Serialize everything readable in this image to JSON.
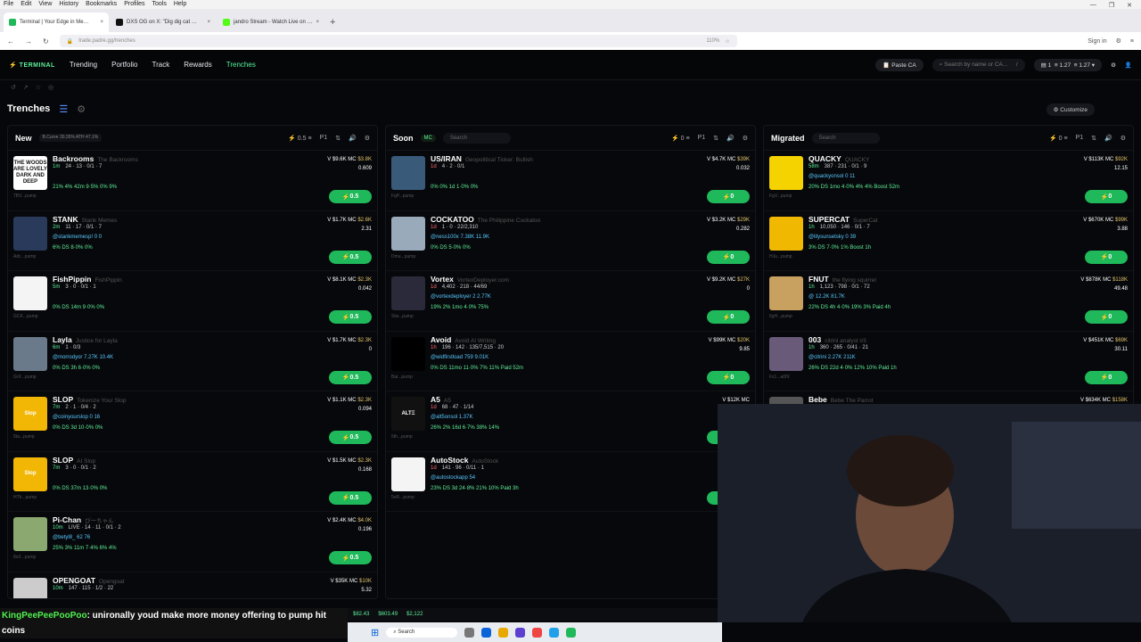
{
  "browser": {
    "menus": [
      "File",
      "Edit",
      "View",
      "History",
      "Bookmarks",
      "Profiles",
      "Tools",
      "Help"
    ],
    "tabs": [
      {
        "label": "Terminal | Your Edge in Me…",
        "color": "#1fb85a"
      },
      {
        "label": "DXS OG on X: \"Dig dig cat …",
        "color": "#111"
      },
      {
        "label": "jandro Stream - Watch Live on …",
        "color": "#53fc18"
      }
    ],
    "url": "trade.padre.gg/trenches",
    "zoom": "110%",
    "signin": "Sign in"
  },
  "header": {
    "logo": "TERMINAL",
    "nav": [
      "Trending",
      "Portfolio",
      "Track",
      "Rewards",
      "Trenches"
    ],
    "active": "Trenches",
    "paste": "Paste CA",
    "search_placeholder": "Search by name or CA...",
    "search_key": "/",
    "wallet": "1",
    "bal1": "1.27",
    "bal2": "1.27"
  },
  "page": {
    "title": "Trenches",
    "customize": "Customize"
  },
  "colors": {
    "accent": "#53f29a",
    "buy": "#1fb85a",
    "handle": "#57c8ff",
    "mc": "#e3c46b"
  },
  "columns": [
    {
      "name": "New",
      "curve": "B.Curve 30.35% ATH 47.1%",
      "amount": "0.5",
      "preset": "P1",
      "items": [
        {
          "name": "Backrooms",
          "sub": "The Backrooms",
          "age": "1m",
          "meta": "24 · 13 · 0/1 · 7",
          "handle": "",
          "stats": "21% 4% 42m 9·5% 0% 9%",
          "v": "$9.6K",
          "mc": "$3.8K",
          "sol": "0.609",
          "addr": "7BV...pump",
          "img": "THE WOODS ARE LOVELY DARK AND DEEP",
          "bg": "#fff",
          "fg": "#111",
          "buy": "0.5"
        },
        {
          "name": "STANK",
          "sub": "Stank Memes",
          "age": "2m",
          "meta": "11 · 17 · 0/1 · 7",
          "handle": "@stankmemesp!  0  0",
          "stats": "6% DS 8·0% 0%",
          "v": "$1.7K",
          "mc": "$2.6K",
          "sol": "2.31",
          "addr": "Adc...pump",
          "img": "",
          "bg": "#2a3a5a",
          "fg": "#fff",
          "buy": "0.5"
        },
        {
          "name": "FishPippin",
          "sub": "FishPippin",
          "age": "5m",
          "meta": "3 · 0 · 0/1 · 1",
          "handle": "",
          "stats": "0% DS 14m 9·0% 0%",
          "v": "$8.1K",
          "mc": "$2.3K",
          "sol": "0.042",
          "addr": "GCK...pump",
          "img": "",
          "bg": "#f4f4f4",
          "fg": "#333",
          "buy": "0.5"
        },
        {
          "name": "Layla",
          "sub": "Justice for Layla",
          "age": "6m",
          "meta": "1 · 0/3",
          "handle": "@morrodyor  7.27K  10.4K",
          "stats": "0% DS 3h 6·0% 0%",
          "v": "$1.7K",
          "mc": "$2.3K",
          "sol": "0",
          "addr": "GrX...pump",
          "img": "",
          "bg": "#6a7a8a",
          "fg": "#fff",
          "buy": "0.5"
        },
        {
          "name": "SLOP",
          "sub": "Tokenize Your Slop",
          "age": "7m",
          "meta": "2 · 1 · 0/4 · 2",
          "handle": "@coinyourslop  0  16",
          "stats": "0% DS 3d 10·0% 0%",
          "v": "$1.1K",
          "mc": "$2.3K",
          "sol": "0.094",
          "addr": "5ta...pump",
          "img": "Slop",
          "bg": "#f2b705",
          "fg": "#fff",
          "buy": "0.5"
        },
        {
          "name": "SLOP",
          "sub": "AI Slop",
          "age": "7m",
          "meta": "3 · 0 · 0/1 · 2",
          "handle": "",
          "stats": "0% DS 37m 13·0% 0%",
          "v": "$1.5K",
          "mc": "$2.3K",
          "sol": "0.168",
          "addr": "HTh...pump",
          "img": "Slop",
          "bg": "#f2b705",
          "fg": "#fff",
          "buy": "0.5"
        },
        {
          "name": "Pi-Chan",
          "sub": "ぴーちゃん",
          "age": "10m",
          "meta": "LIVE · 14 · 11 · 0/1 · 2",
          "handle": "@betyl8_  62  76",
          "stats": "25% 3% 11m 7·4% 6% 4%",
          "v": "$2.4K",
          "mc": "$4.0K",
          "sol": "0.196",
          "addr": "8sX...pump",
          "img": "",
          "bg": "#8aa870",
          "fg": "#fff",
          "buy": "0.5"
        },
        {
          "name": "OPENGOAT",
          "sub": "Opengoat",
          "age": "10m",
          "meta": "147 · 115 · 1/2 · 22",
          "handle": "",
          "stats": "",
          "v": "$35K",
          "mc": "$10K",
          "sol": "5.32",
          "addr": "",
          "img": "",
          "bg": "#ccc",
          "fg": "#111",
          "buy": ""
        }
      ]
    },
    {
      "name": "Soon",
      "tag": "MC",
      "search": "Search",
      "amount": "0",
      "preset": "P1",
      "items": [
        {
          "name": "US/IRAN",
          "sub": "Geopolitical Ticker: Bullish",
          "age": "1d",
          "meta": "4 · 2 · 0/1",
          "handle": "",
          "stats": "0% 0% 1d 1·0% 0%",
          "v": "$4.7K",
          "mc": "$39K",
          "sol": "0.032",
          "addr": "FgP...pump",
          "img": "",
          "bg": "#3a5a7a",
          "fg": "#fff",
          "buy": "0"
        },
        {
          "name": "COCKATOO",
          "sub": "The Philippine Cockatoo",
          "age": "1d",
          "meta": "1 · 0 · 22/2,310",
          "handle": "@ness100x  7.38K  11.9K",
          "stats": "0% DS 5·0% 0%",
          "v": "$3.2K",
          "mc": "$29K",
          "sol": "0.282",
          "addr": "Dmu...pump",
          "img": "",
          "bg": "#9ab",
          "fg": "#fff",
          "buy": "0"
        },
        {
          "name": "Vortex",
          "sub": "VortexDeployer.com",
          "age": "1d",
          "meta": "4,402 · 218 · 44/69",
          "handle": "@vortexdeployer  2  2.77K",
          "stats": "19% 2% 1mo 4·0% 75%",
          "v": "$9.2K",
          "mc": "$27K",
          "sol": "0",
          "addr": "Stw...pump",
          "img": "",
          "bg": "#2a2a3a",
          "fg": "#a67bff",
          "buy": "0"
        },
        {
          "name": "Avoid",
          "sub": "Avoid AI Writing",
          "age": "1h",
          "meta": "196 · 142 · 135/7,515 · 20",
          "handle": "@widfirstload  759  9.01K",
          "stats": "0% DS 11mo 11·0% 7% 11% Paid 52m",
          "v": "$99K",
          "mc": "$20K",
          "sol": "9.85",
          "addr": "Bai...pump",
          "img": "",
          "bg": "#000",
          "fg": "#fff",
          "buy": "0"
        },
        {
          "name": "A5",
          "sub": "A5",
          "age": "1d",
          "meta": "68 · 47 · 1/14",
          "handle": "@alt5onsol  1.37K",
          "stats": "26% 2% 16d 6·7% 38% 14%",
          "v": "$12K",
          "mc": "",
          "sol": "",
          "addr": "5th...pump",
          "img": "ALTΞ",
          "bg": "#111",
          "fg": "#fff",
          "buy": "0"
        },
        {
          "name": "AutoStock",
          "sub": "AutoStock",
          "age": "1d",
          "meta": "141 · 96 · 0/11 · 1",
          "handle": "@autostockapp  54",
          "stats": "23% DS 3d 24·8% 21% 10% Paid 3h",
          "v": "$9",
          "mc": "",
          "sol": "",
          "addr": "5eR...pump",
          "img": "",
          "bg": "#f4f4f4",
          "fg": "#111",
          "buy": "0"
        }
      ]
    },
    {
      "name": "Migrated",
      "search": "Search",
      "amount": "0",
      "preset": "P1",
      "items": [
        {
          "name": "QUACKY",
          "sub": "QUACKY",
          "age": "58m",
          "meta": "387 · 231 · 0/1 · 9",
          "handle": "@quackyonsol  0  11",
          "stats": "20% DS 1mo 4·0% 4% 4% Boost 52m",
          "v": "$113K",
          "mc": "$92K",
          "sol": "12.15",
          "addr": "FgV...pump",
          "img": "",
          "bg": "#f5d300",
          "fg": "#111",
          "buy": "0"
        },
        {
          "name": "SUPERCAT",
          "sub": "SuperCat",
          "age": "1h",
          "meta": "10,050 · 146 · 0/1 · 7",
          "handle": "@lilysunsetsky  0  39",
          "stats": "3% DS 7·0% 1% Boost 1h",
          "v": "$670K",
          "mc": "$99K",
          "sol": "3.88",
          "addr": "HJu...pump",
          "img": "",
          "bg": "#f0b800",
          "fg": "#111",
          "buy": "0"
        },
        {
          "name": "FNUT",
          "sub": "the flying squirrel",
          "age": "1h",
          "meta": "1,123 · 798 · 0/1 · 72",
          "handle": "@  12.2K  81.7K",
          "stats": "22% DS 4h 4·0% 19% 3% Paid 4h",
          "v": "$878K",
          "mc": "$118K",
          "sol": "49.48",
          "addr": "6gH...pump",
          "img": "",
          "bg": "#c8a060",
          "fg": "#fff",
          "buy": "0"
        },
        {
          "name": "003",
          "sub": "citrini analyst #3",
          "age": "1h",
          "meta": "360 · 265 · 0/41 · 21",
          "handle": "@citrini  2.27K  211K",
          "stats": "26% DS 22d 4·0% 12% 10% Paid 1h",
          "v": "$451K",
          "mc": "$69K",
          "sol": "30.11",
          "addr": "Fz1...a0fX",
          "img": "",
          "bg": "#6a5a7a",
          "fg": "#fff",
          "buy": "0"
        },
        {
          "name": "Bebe",
          "sub": "Bebe The Parrot",
          "age": "",
          "meta": "",
          "handle": "",
          "stats": "",
          "v": "$634K",
          "mc": "$158K",
          "sol": "",
          "addr": "",
          "img": "",
          "bg": "#555",
          "fg": "#fff",
          "buy": ""
        }
      ]
    }
  ],
  "chat": {
    "user": "KingPeePeePooPoo",
    "message": ": unironally youd make more money offering to pump hit",
    "line2": "coins"
  },
  "ticker": [
    "$82.43",
    "$603.49",
    "$2,122"
  ],
  "taskbar": {
    "search": "Search"
  }
}
